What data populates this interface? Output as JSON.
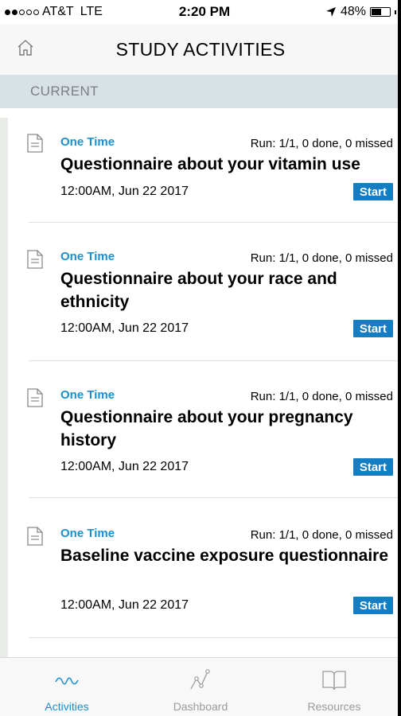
{
  "status_bar": {
    "carrier": "AT&T",
    "network": "LTE",
    "time": "2:20 PM",
    "battery": "48%",
    "battery_level": 0.48
  },
  "header": {
    "title": "STUDY ACTIVITIES",
    "home_icon": "home-icon"
  },
  "section": {
    "label": "CURRENT"
  },
  "activities": [
    {
      "frequency": "One Time",
      "run_status": "Run: 1/1, 0 done, 0 missed",
      "title": "Questionnaire about your vitamin use",
      "date": "12:00AM, Jun 22 2017",
      "button": "Start"
    },
    {
      "frequency": "One Time",
      "run_status": "Run: 1/1, 0 done, 0 missed",
      "title": "Questionnaire about your race and ethnicity",
      "date": "12:00AM, Jun 22 2017",
      "button": "Start"
    },
    {
      "frequency": "One Time",
      "run_status": "Run: 1/1, 0 done, 0 missed",
      "title": "Questionnaire about your pregnancy history",
      "date": "12:00AM, Jun 22 2017",
      "button": "Start"
    },
    {
      "frequency": "One Time",
      "run_status": "Run: 1/1, 0 done, 0 missed",
      "title": "Baseline vaccine exposure questionnaire",
      "date": "12:00AM, Jun 22 2017",
      "button": "Start"
    }
  ],
  "tabs": [
    {
      "label": "Activities",
      "icon": "activities-wave-icon",
      "active": true
    },
    {
      "label": "Dashboard",
      "icon": "dashboard-graph-icon",
      "active": false
    },
    {
      "label": "Resources",
      "icon": "resources-book-icon",
      "active": false
    }
  ],
  "colors": {
    "accent": "#1a8fce",
    "button": "#157dc3",
    "section_bg": "#d8e1e5",
    "inactive_tab": "#9b9b9b"
  }
}
